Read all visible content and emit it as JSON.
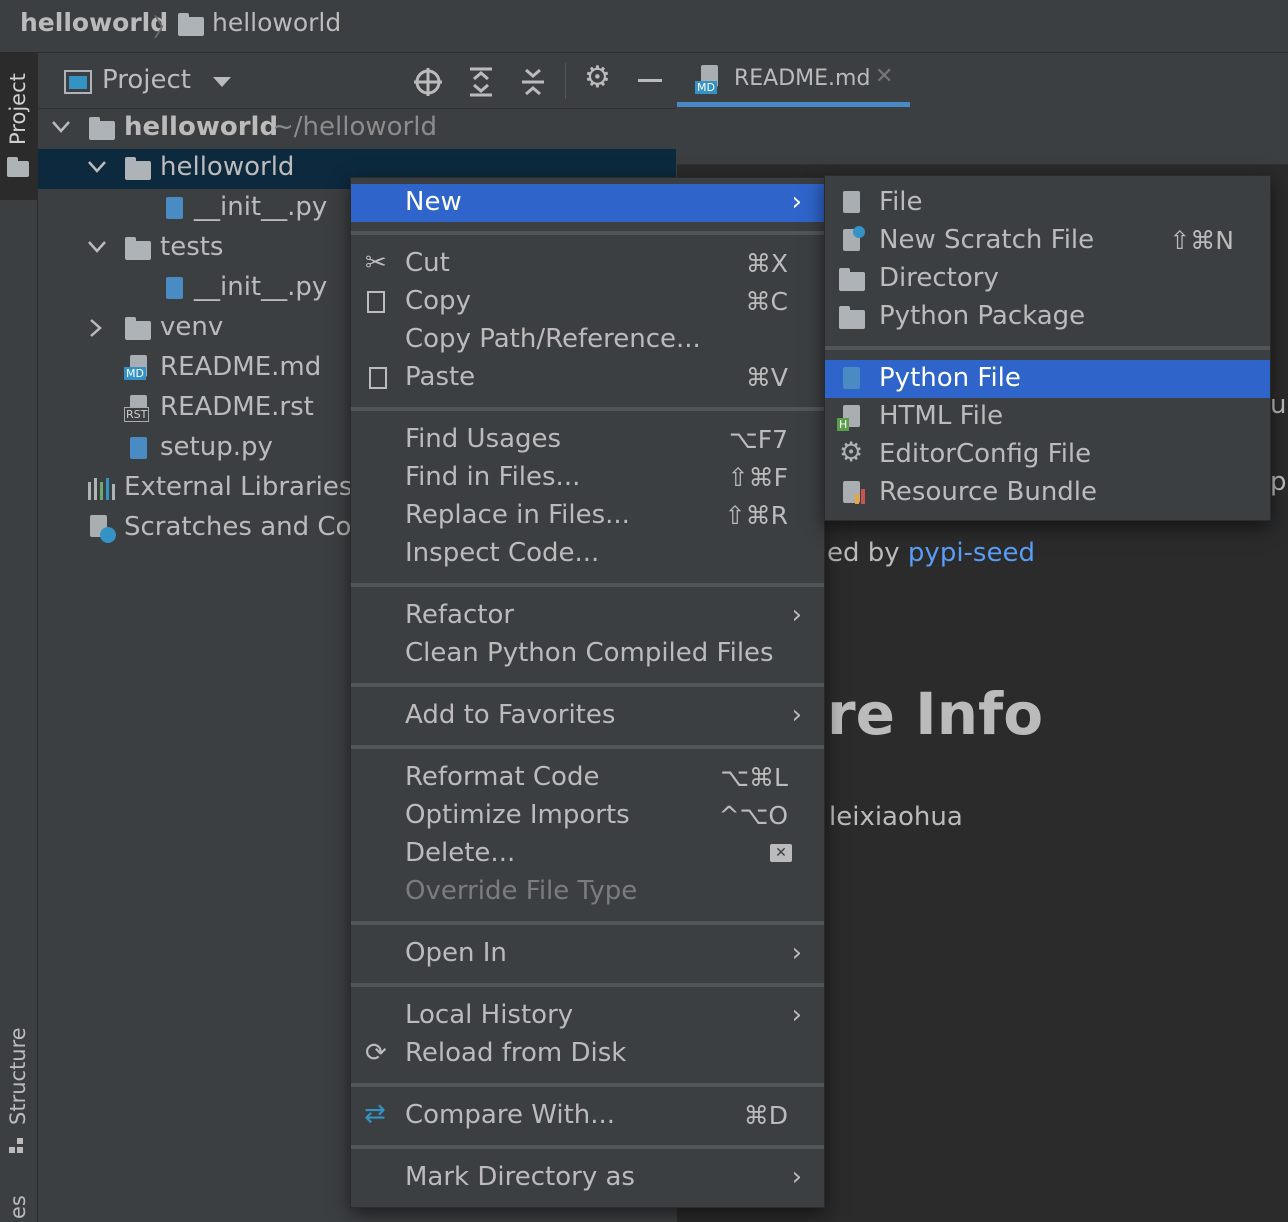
{
  "navbar": {
    "project": "helloworld",
    "folder": "helloworld"
  },
  "stripe": {
    "top_tab": "Project",
    "bottom_tab": "Structure",
    "bottom_tab2": "es"
  },
  "panel": {
    "title": "Project"
  },
  "tree": {
    "root": {
      "name": "helloworld",
      "path": "~/helloworld"
    },
    "items": [
      "helloworld",
      "__init__.py",
      "tests",
      "__init__.py",
      "venv",
      "README.md",
      "README.rst",
      "setup.py",
      "External Libraries",
      "Scratches and Con"
    ]
  },
  "editor": {
    "tab": "README.md",
    "line1_prefix": "ed by ",
    "line1_link": "pypi-seed",
    "heading": "re Info",
    "author": "leixiaohua",
    "edge_frag1": "ur",
    "edge_frag2": "p"
  },
  "context_menu": {
    "new": "New",
    "cut": "Cut",
    "cut_key": "⌘X",
    "copy": "Copy",
    "copy_key": "⌘C",
    "copy_path": "Copy Path/Reference...",
    "paste": "Paste",
    "paste_key": "⌘V",
    "find_usages": "Find Usages",
    "find_usages_key": "⌥F7",
    "find_in_files": "Find in Files...",
    "find_in_files_key": "⇧⌘F",
    "replace_in_files": "Replace in Files...",
    "replace_in_files_key": "⇧⌘R",
    "inspect": "Inspect Code...",
    "refactor": "Refactor",
    "clean": "Clean Python Compiled Files",
    "favorites": "Add to Favorites",
    "reformat": "Reformat Code",
    "reformat_key": "⌥⌘L",
    "optimize": "Optimize Imports",
    "optimize_key": "^⌥O",
    "delete": "Delete...",
    "override": "Override File Type",
    "open_in": "Open In",
    "local_history": "Local History",
    "reload": "Reload from Disk",
    "compare": "Compare With...",
    "compare_key": "⌘D",
    "mark_dir": "Mark Directory as"
  },
  "submenu": {
    "file": "File",
    "scratch": "New Scratch File",
    "scratch_key": "⇧⌘N",
    "directory": "Directory",
    "package": "Python Package",
    "python_file": "Python File",
    "html_file": "HTML File",
    "editorconfig": "EditorConfig File",
    "resource_bundle": "Resource Bundle"
  }
}
